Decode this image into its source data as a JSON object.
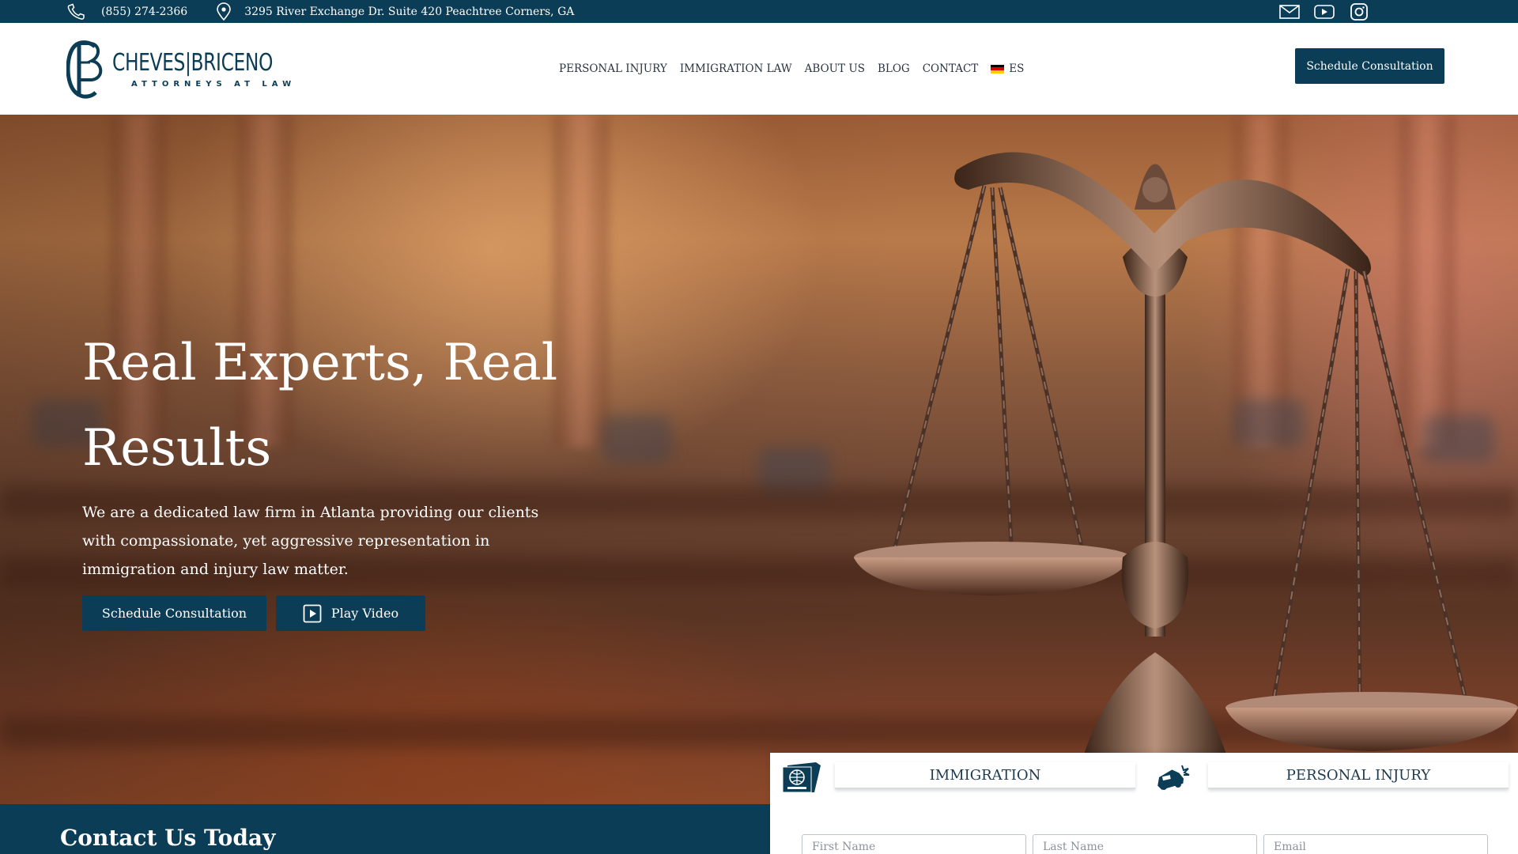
{
  "topbar": {
    "phone": "(855) 274-2366",
    "address": "3295 River Exchange Dr. Suite 420 Peachtree Corners, GA",
    "icons": [
      "phone-icon",
      "location-pin-icon",
      "mail-icon",
      "youtube-icon",
      "instagram-icon"
    ]
  },
  "header": {
    "logo": {
      "name": "CHEVES|BRICENO",
      "tagline": "ATTORNEYS AT LAW"
    },
    "nav": [
      {
        "label": "PERSONAL INJURY"
      },
      {
        "label": "IMMIGRATION LAW"
      },
      {
        "label": "ABOUT US"
      },
      {
        "label": "BLOG"
      },
      {
        "label": "CONTACT"
      }
    ],
    "language": {
      "label": "ES",
      "flag_colors": [
        "#000000",
        "#dd0000",
        "#ffce00"
      ]
    },
    "cta_label": "Schedule Consultation"
  },
  "hero": {
    "title": "Real Experts, Real Results",
    "subtitle": "We are a dedicated law firm in Atlanta providing our clients with compassionate, yet aggressive representation in immigration and injury law matter.",
    "buttons": {
      "schedule": "Schedule Consultation",
      "video": "Play Video"
    }
  },
  "contact_section": {
    "title": "Contact Us Today"
  },
  "practice_form": {
    "tabs": [
      {
        "label": "IMMIGRATION",
        "icon": "passport-icon"
      },
      {
        "label": "PERSONAL INJURY",
        "icon": "car-crash-icon"
      }
    ],
    "fields": [
      {
        "placeholder": "First Name"
      },
      {
        "placeholder": "Last Name"
      },
      {
        "placeholder": "Email"
      }
    ]
  },
  "colors": {
    "brand": "#0b3d56",
    "white": "#ffffff"
  }
}
